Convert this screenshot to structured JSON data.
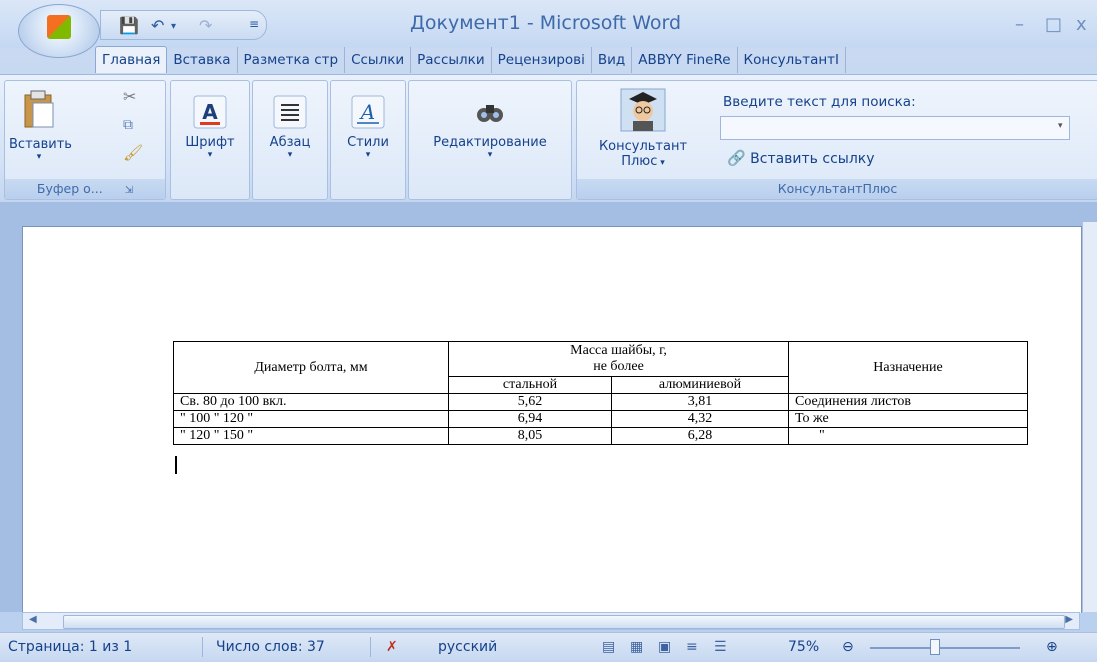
{
  "window": {
    "title": "Документ1 - Microsoft Word"
  },
  "tabs": [
    "Главная",
    "Вставка",
    "Разметка стр",
    "Ссылки",
    "Рассылки",
    "Рецензирові",
    "Вид",
    "ABBYY FineRe",
    "КонсультантI"
  ],
  "ribbon": {
    "clipboard": {
      "paste_label": "Вставить",
      "group_label": "Буфер о..."
    },
    "font": {
      "label": "Шрифт"
    },
    "paragraph": {
      "label": "Абзац"
    },
    "styles": {
      "label": "Стили"
    },
    "editing": {
      "label": "Редактирование"
    },
    "consultant": {
      "button_line1": "Консультант",
      "button_line2": "Плюс",
      "search_label": "Введите текст для поиска:",
      "search_value": "",
      "insert_link_label": "Вставить ссылку",
      "group_label": "КонсультантПлюс"
    }
  },
  "table": {
    "header": {
      "diameter": "Диаметр болта, мм",
      "mass_line1": "Масса шайбы, г,",
      "mass_line2": "не более",
      "purpose": "Назначение",
      "steel": "стальной",
      "aluminum": "алюминиевой"
    },
    "rows": [
      {
        "diameter": "Св.  80   до  100 вкл.",
        "steel": "5,62",
        "aluminum": "3,81",
        "purpose": "Соединения листов"
      },
      {
        "diameter": "\"  100   \"   120   \"",
        "steel": "6,94",
        "aluminum": "4,32",
        "purpose": "То же"
      },
      {
        "diameter": "\"   120   \"   150   \"",
        "steel": "8,05",
        "aluminum": "6,28",
        "purpose": "\""
      }
    ]
  },
  "statusbar": {
    "page": "Страница: 1 из 1",
    "words": "Число слов: 37",
    "language": "русский",
    "zoom": "75%"
  }
}
